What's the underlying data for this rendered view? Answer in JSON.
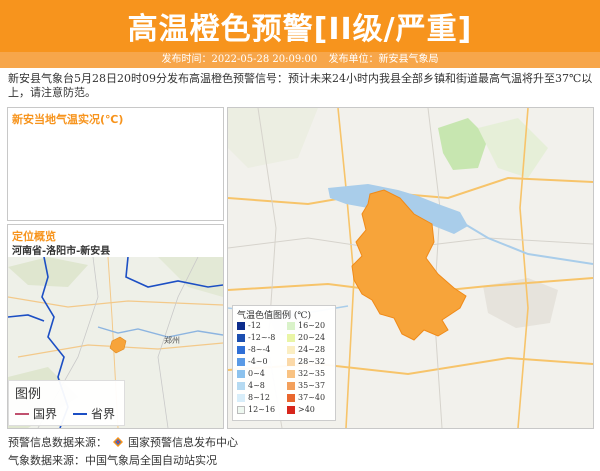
{
  "header": {
    "title": "高温橙色预警[II级/严重]",
    "publish_time": "发布时间：2022-05-28 20:09:00",
    "publisher": "发布单位：新安县气象局"
  },
  "intro": "新安县气象台5月28日20时09分发布高温橙色预警信号：预计未来24小时内我县全部乡镇和街道最高气温将升至37℃以上，请注意防范。",
  "temp_panel": {
    "title": "新安当地气温实况(℃)"
  },
  "location_panel": {
    "title": "定位概览",
    "path": "河南省-洛阳市-新安县",
    "map_labels": [
      "郑州"
    ],
    "legend": {
      "title": "图例",
      "items": [
        {
          "label": "国界",
          "color": "#c0506e"
        },
        {
          "label": "省界",
          "color": "#1c4fc4"
        }
      ]
    }
  },
  "main_map": {
    "highlight_color": "#f7a43a",
    "legend": {
      "title": "气温色值图例 (℃)",
      "left": [
        {
          "label": "-12",
          "color": "#0d2d8c"
        },
        {
          "label": "-12~-8",
          "color": "#1c4fb0"
        },
        {
          "label": "-8~-4",
          "color": "#2f6fd6"
        },
        {
          "label": "-4~0",
          "color": "#5a9ae6"
        },
        {
          "label": "0~4",
          "color": "#8cc2ee"
        },
        {
          "label": "4~8",
          "color": "#b5daf2"
        },
        {
          "label": "8~12",
          "color": "#d8eefa"
        },
        {
          "label": "12~16",
          "color": "#eef8f0"
        }
      ],
      "right": [
        {
          "label": "16~20",
          "color": "#d9f2c9"
        },
        {
          "label": "20~24",
          "color": "#e9f5a6"
        },
        {
          "label": "24~28",
          "color": "#fbeec2"
        },
        {
          "label": "28~32",
          "color": "#fbd9a8"
        },
        {
          "label": "32~35",
          "color": "#f9c383"
        },
        {
          "label": "35~37",
          "color": "#f3a05c"
        },
        {
          "label": "37~40",
          "color": "#e9672e"
        },
        {
          "label": ">40",
          "color": "#d7261b"
        }
      ]
    }
  },
  "footer": {
    "warning_source": "预警信息数据来源：",
    "warning_source_name": "国家预警信息发布中心",
    "weather_source": "气象数据来源：中国气象局全国自动站实况"
  },
  "colors": {
    "accent": "#f7941d",
    "subbar": "#f7a64a"
  }
}
